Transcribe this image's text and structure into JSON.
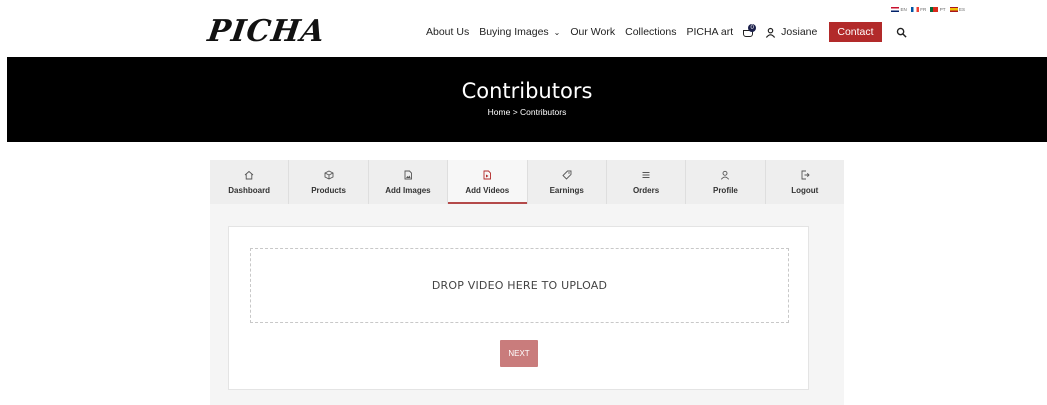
{
  "header": {
    "logo_text": "PICHA",
    "nav": [
      {
        "label": "About Us"
      },
      {
        "label": "Buying Images",
        "has_dropdown": true
      },
      {
        "label": "Our Work"
      },
      {
        "label": "Collections"
      },
      {
        "label": "PICHA art"
      }
    ],
    "cart_count": "0",
    "user_name": "Josiane",
    "contact_label": "Contact",
    "languages": [
      "EN",
      "FR",
      "PT",
      "ES"
    ]
  },
  "hero": {
    "title": "Contributors",
    "breadcrumb": "Home > Contributors"
  },
  "dashboard": {
    "tabs": [
      {
        "label": "Dashboard",
        "icon": "home-icon"
      },
      {
        "label": "Products",
        "icon": "box-icon"
      },
      {
        "label": "Add Images",
        "icon": "image-file-icon"
      },
      {
        "label": "Add Videos",
        "icon": "video-file-icon",
        "active": true
      },
      {
        "label": "Earnings",
        "icon": "tag-icon"
      },
      {
        "label": "Orders",
        "icon": "list-icon"
      },
      {
        "label": "Profile",
        "icon": "user-icon"
      },
      {
        "label": "Logout",
        "icon": "logout-icon"
      }
    ],
    "dropzone_text": "DROP VIDEO HERE TO UPLOAD",
    "next_label": "NEXT"
  },
  "colors": {
    "accent": "#b22a2a",
    "next_button": "#c97c7c",
    "hero_bg": "#000000"
  }
}
